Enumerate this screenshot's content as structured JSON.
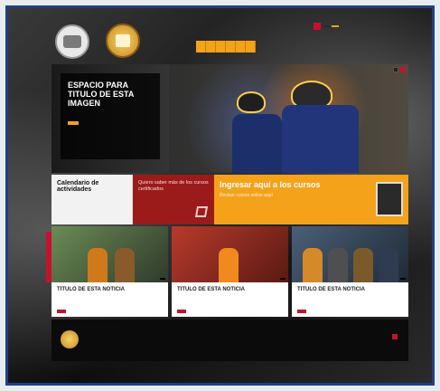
{
  "header": {
    "utility": {
      "link": "",
      "cta": ""
    },
    "nav": [
      "",
      "",
      "",
      "",
      "",
      ""
    ]
  },
  "hero": {
    "title": "ESPACIO PARA TITULO DE ESTA IMAGEN",
    "description": "",
    "button_label": ""
  },
  "promos": [
    {
      "title": "Calendario de actividades",
      "desc": ""
    },
    {
      "title": "Quiero saber más de los cursos certificados",
      "desc": ""
    },
    {
      "title": "Ingresar aquí a los cursos",
      "desc": "Revisar cursos online aquí"
    }
  ],
  "cards": [
    {
      "title": "TITULO DE ESTA NOTICIA",
      "desc": "",
      "button": "",
      "label": ""
    },
    {
      "title": "TITULO DE ESTA NOTICIA",
      "desc": "",
      "button": "",
      "label": ""
    },
    {
      "title": "TITULO DE ESTA NOTICIA",
      "desc": "",
      "button": "",
      "label": ""
    }
  ],
  "footer": {
    "links": [
      "",
      "",
      "",
      "",
      ""
    ],
    "right_text": ""
  },
  "colors": {
    "accent": "#f4a21a",
    "red": "#c8102e",
    "frame_border": "#1f3f86",
    "dark": "#0b0b0b"
  },
  "icons": [
    "shield-icon",
    "seal-icon",
    "flag-icon",
    "edit-icon",
    "screen-icon"
  ]
}
